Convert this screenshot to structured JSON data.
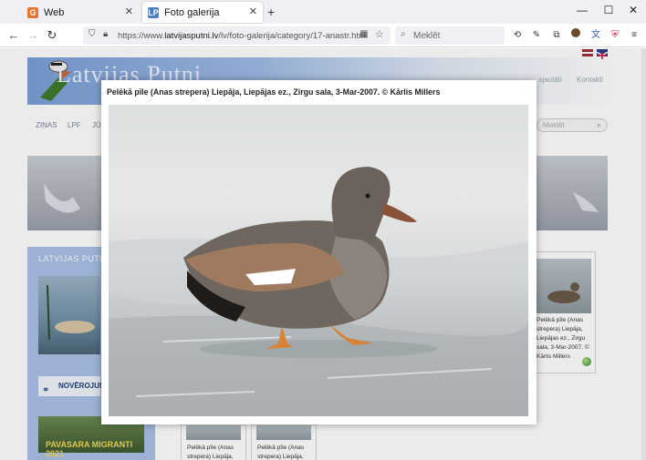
{
  "browser": {
    "tabs": [
      {
        "title": "Web",
        "active": false
      },
      {
        "title": "Foto galerija",
        "active": true
      }
    ],
    "new_tab_icon": "+",
    "url_prefix": "https://www.",
    "url_domain": "latvijasputni.lv",
    "url_path": "/lv/foto-galerija/category/17-anastr.html",
    "search_placeholder": "Meklēt"
  },
  "site": {
    "logo_text": "Latvijas Putni",
    "top_menu": [
      "ajautāti",
      "Kontakti"
    ],
    "main_nav": [
      "ZIŅAS",
      "LPF",
      "JŪ"
    ],
    "search_placeholder": "Meklēt",
    "sidebar_title": "LATVIJAS PUTNI",
    "observations_label": "NOVĒROJUMI",
    "migration_label": "PAVASARA MIGRANTI 2021"
  },
  "lightbox": {
    "caption": "Pelēkā pīle (Anas strepera) Liepāja, Liepājas ez., Zirgu sala, 3-Mar-2007. © Kārlis Millers"
  },
  "thumbnails": {
    "right_caption_lines": [
      "Pelēkā pīle (Anas",
      "strepera) Liepāja,",
      "Liepājas ez., Zirgu",
      "sala, 3-Mar-2007. ©",
      "Kārlis Millers"
    ],
    "bottom_caption_lines": [
      "Pelēkā pīle (Anas",
      "strepera) Liepāja,"
    ]
  },
  "colors": {
    "sidebar": "#aac0e6",
    "accent_blue": "#1c3d7a"
  }
}
